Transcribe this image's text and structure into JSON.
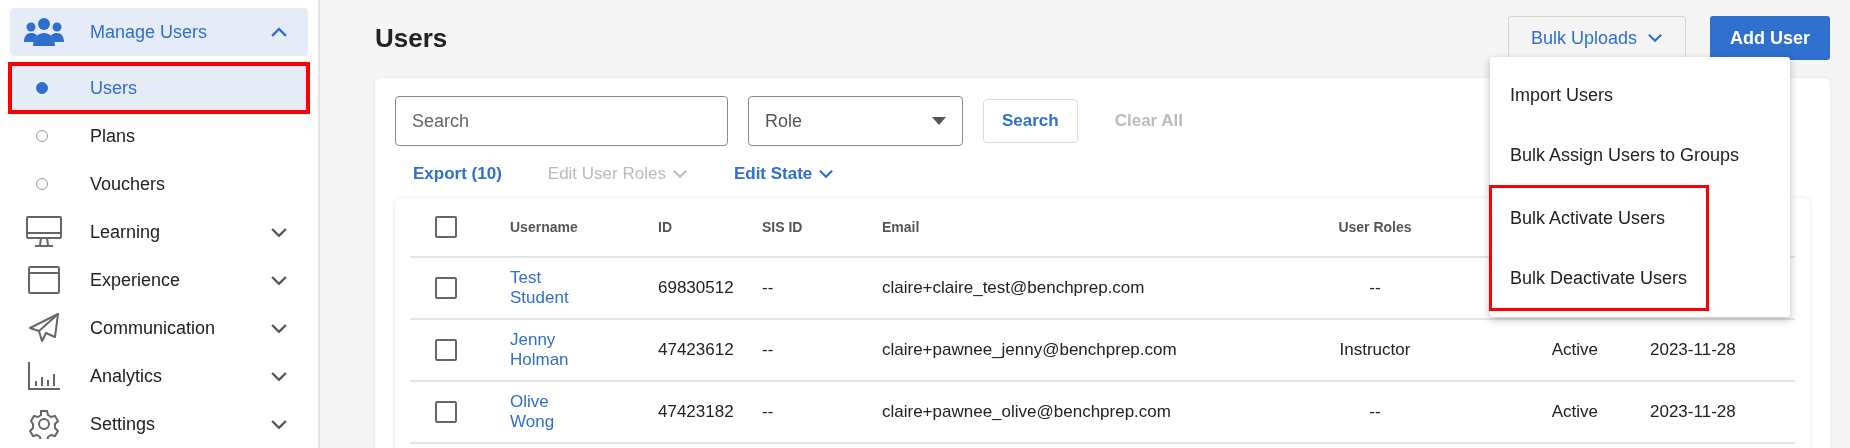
{
  "sidebar": {
    "items": [
      {
        "label": "Manage Users",
        "selected": true,
        "expanded": true,
        "children": [
          {
            "label": "Users",
            "selected": true,
            "highlighted": true
          },
          {
            "label": "Plans",
            "selected": false,
            "highlighted": false
          },
          {
            "label": "Vouchers",
            "selected": false,
            "highlighted": false
          }
        ]
      },
      {
        "label": "Learning",
        "selected": false,
        "expanded": false
      },
      {
        "label": "Experience",
        "selected": false,
        "expanded": false
      },
      {
        "label": "Communication",
        "selected": false,
        "expanded": false
      },
      {
        "label": "Analytics",
        "selected": false,
        "expanded": false
      },
      {
        "label": "Settings",
        "selected": false,
        "expanded": false
      }
    ]
  },
  "page": {
    "title": "Users",
    "bulk_uploads": {
      "label": "Bulk Uploads",
      "expanded": true,
      "menu": [
        {
          "label": "Import Users",
          "highlighted": false
        },
        {
          "label": "Bulk Assign Users to Groups",
          "highlighted": false
        },
        {
          "label": "Bulk Activate Users",
          "highlighted": true
        },
        {
          "label": "Bulk Deactivate Users",
          "highlighted": true
        }
      ]
    },
    "add_user": {
      "label": "Add User"
    }
  },
  "filters": {
    "search": {
      "placeholder": "Search"
    },
    "role": {
      "placeholder": "Role"
    },
    "search_button": "Search",
    "clear": {
      "label": "Clear All",
      "disabled": true
    }
  },
  "actions": [
    {
      "label": "Export (10)",
      "disabled": false,
      "dropdown": false
    },
    {
      "label": "Edit User Roles",
      "disabled": true,
      "dropdown": true
    },
    {
      "label": "Edit State",
      "disabled": false,
      "dropdown": true
    }
  ],
  "table": {
    "select_all": {
      "checked": false
    },
    "columns": [
      "Username",
      "ID",
      "SIS ID",
      "Email",
      "User Roles"
    ],
    "rows": [
      {
        "checked": false,
        "cells": [
          "Test Student",
          "69830512",
          "--",
          "claire+claire_test@benchprep.com",
          "--"
        ]
      },
      {
        "checked": false,
        "cells": [
          "Jenny Holman",
          "47423612",
          "--",
          "claire+pawnee_jenny@benchprep.com",
          "Instructor",
          "Active",
          "2023-11-28"
        ]
      },
      {
        "checked": false,
        "cells": [
          "Olive Wong",
          "47423182",
          "--",
          "claire+pawnee_olive@benchprep.com",
          "--",
          "Active",
          "2023-11-28"
        ]
      }
    ]
  }
}
